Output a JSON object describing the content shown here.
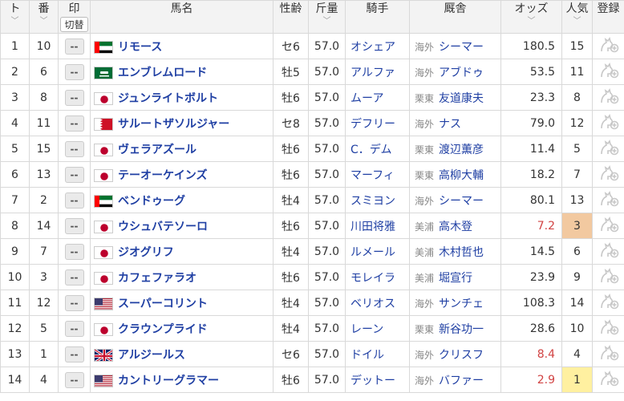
{
  "headers": {
    "waku": "ト",
    "umaban": "番",
    "mark": "印",
    "mark_toggle": "切替",
    "horse": "馬名",
    "sex_age": "性齢",
    "weight": "斤量",
    "jockey": "騎手",
    "trainer": "厩舎",
    "odds": "オッズ",
    "popularity": "人気",
    "register": "登録",
    "sort_glyph": "﹀"
  },
  "rows": [
    {
      "waku": "1",
      "umaban": "10",
      "mark": "--",
      "flag": "uae",
      "horse": "リモース",
      "sex_age": "セ6",
      "weight": "57.0",
      "jockey": "オシェア",
      "affil": "海外",
      "trainer": "シーマー",
      "odds": "180.5",
      "pop": "15",
      "hot": false
    },
    {
      "waku": "2",
      "umaban": "6",
      "mark": "--",
      "flag": "saudi",
      "horse": "エンブレムロード",
      "sex_age": "牡5",
      "weight": "57.0",
      "jockey": "アルファ",
      "affil": "海外",
      "trainer": "アブドゥ",
      "odds": "53.5",
      "pop": "11",
      "hot": false
    },
    {
      "waku": "3",
      "umaban": "8",
      "mark": "--",
      "flag": "japan",
      "horse": "ジュンライトボルト",
      "sex_age": "牡6",
      "weight": "57.0",
      "jockey": "ムーア",
      "affil": "栗東",
      "trainer": "友道康夫",
      "odds": "23.3",
      "pop": "8",
      "hot": false
    },
    {
      "waku": "4",
      "umaban": "11",
      "mark": "--",
      "flag": "bahrain",
      "horse": "サルートザソルジャー",
      "sex_age": "セ8",
      "weight": "57.0",
      "jockey": "デフリー",
      "affil": "海外",
      "trainer": "ナス",
      "odds": "79.0",
      "pop": "12",
      "hot": false
    },
    {
      "waku": "5",
      "umaban": "15",
      "mark": "--",
      "flag": "japan",
      "horse": "ヴェラアズール",
      "sex_age": "牡6",
      "weight": "57.0",
      "jockey": "C．デム",
      "affil": "栗東",
      "trainer": "渡辺薫彦",
      "odds": "11.4",
      "pop": "5",
      "hot": false
    },
    {
      "waku": "6",
      "umaban": "13",
      "mark": "--",
      "flag": "japan",
      "horse": "テーオーケインズ",
      "sex_age": "牡6",
      "weight": "57.0",
      "jockey": "マーフィ",
      "affil": "栗東",
      "trainer": "高柳大輔",
      "odds": "18.2",
      "pop": "7",
      "hot": false
    },
    {
      "waku": "7",
      "umaban": "2",
      "mark": "--",
      "flag": "uae",
      "horse": "ベンドゥーグ",
      "sex_age": "牡4",
      "weight": "57.0",
      "jockey": "スミヨン",
      "affil": "海外",
      "trainer": "シーマー",
      "odds": "80.1",
      "pop": "13",
      "hot": false
    },
    {
      "waku": "8",
      "umaban": "14",
      "mark": "--",
      "flag": "japan",
      "horse": "ウシュバテソーロ",
      "sex_age": "牡6",
      "weight": "57.0",
      "jockey": "川田将雅",
      "affil": "美浦",
      "trainer": "高木登",
      "odds": "7.2",
      "pop": "3",
      "hot": true
    },
    {
      "waku": "9",
      "umaban": "7",
      "mark": "--",
      "flag": "japan",
      "horse": "ジオグリフ",
      "sex_age": "牡4",
      "weight": "57.0",
      "jockey": "ルメール",
      "affil": "美浦",
      "trainer": "木村哲也",
      "odds": "14.5",
      "pop": "6",
      "hot": false
    },
    {
      "waku": "10",
      "umaban": "3",
      "mark": "--",
      "flag": "japan",
      "horse": "カフェファラオ",
      "sex_age": "牡6",
      "weight": "57.0",
      "jockey": "モレイラ",
      "affil": "美浦",
      "trainer": "堀宣行",
      "odds": "23.9",
      "pop": "9",
      "hot": false
    },
    {
      "waku": "11",
      "umaban": "12",
      "mark": "--",
      "flag": "usa",
      "horse": "スーパーコリント",
      "sex_age": "牡4",
      "weight": "57.0",
      "jockey": "ベリオス",
      "affil": "海外",
      "trainer": "サンチェ",
      "odds": "108.3",
      "pop": "14",
      "hot": false
    },
    {
      "waku": "12",
      "umaban": "5",
      "mark": "--",
      "flag": "japan",
      "horse": "クラウンプライド",
      "sex_age": "牡4",
      "weight": "57.0",
      "jockey": "レーン",
      "affil": "栗東",
      "trainer": "新谷功一",
      "odds": "28.6",
      "pop": "10",
      "hot": false
    },
    {
      "waku": "13",
      "umaban": "1",
      "mark": "--",
      "flag": "uk",
      "horse": "アルジールス",
      "sex_age": "セ6",
      "weight": "57.0",
      "jockey": "ドイル",
      "affil": "海外",
      "trainer": "クリスフ",
      "odds": "8.4",
      "pop": "4",
      "hot": true
    },
    {
      "waku": "14",
      "umaban": "4",
      "mark": "--",
      "flag": "usa",
      "horse": "カントリーグラマー",
      "sex_age": "牡6",
      "weight": "57.0",
      "jockey": "デットー",
      "affil": "海外",
      "trainer": "バファー",
      "odds": "2.9",
      "pop": "1",
      "hot": true
    }
  ],
  "colors": {
    "link": "#1f3fa3",
    "hot_odds": "#d14343",
    "pop1_bg": "#fff0a0",
    "pop3_bg": "#f2c9a0"
  }
}
